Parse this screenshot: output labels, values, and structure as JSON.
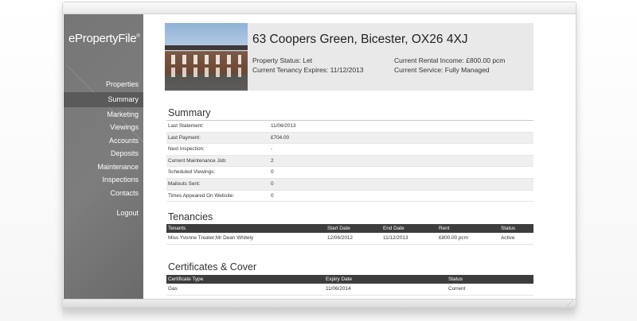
{
  "app": {
    "logo_text": "ePropertyFile",
    "logo_mark": "®"
  },
  "sidebar": {
    "items": [
      {
        "label": "Properties"
      },
      {
        "label": "Summary",
        "active": true
      },
      {
        "label": "Marketing"
      },
      {
        "label": "Viewings"
      },
      {
        "label": "Accounts"
      },
      {
        "label": "Deposits"
      },
      {
        "label": "Maintenance"
      },
      {
        "label": "Inspections"
      },
      {
        "label": "Contacts"
      }
    ],
    "logout_label": "Logout"
  },
  "property": {
    "address": "63 Coopers Green, Bicester, OX26 4XJ",
    "status": "Property Status: Let",
    "tenancy_expires": "Current Tenancy Expires: 11/12/2013",
    "rental_income": "Current Rental Income: £800.00 pcm",
    "service": "Current Service: Fully Managed"
  },
  "summary": {
    "title": "Summary",
    "rows": [
      {
        "label": "Last Statement:",
        "value": "11/06/2013"
      },
      {
        "label": "Last Payment:",
        "value": "£704.00"
      },
      {
        "label": "Next Inspection:",
        "value": "-"
      },
      {
        "label": "Current Maintenance Job:",
        "value": "2"
      },
      {
        "label": "Scheduled Viewings:",
        "value": "0"
      },
      {
        "label": "Mailouts Sent:",
        "value": "0"
      },
      {
        "label": "Times Appeared On Website:",
        "value": "0"
      }
    ]
  },
  "tenancies": {
    "title": "Tenancies",
    "columns": [
      "Tenants",
      "Start Date",
      "End Date",
      "Rent",
      "Status"
    ],
    "rows": [
      [
        "Miss Yvonne Treater;Mr Dean Whitely",
        "12/06/2012",
        "11/12/2013",
        "£800.00 pcm",
        "Active"
      ]
    ]
  },
  "certificates": {
    "title": "Certificates & Cover",
    "columns": [
      "Certificate Type",
      "Expiry Date",
      "Status"
    ],
    "rows": [
      [
        "Gas",
        "11/06/2014",
        "Current"
      ]
    ]
  },
  "window": {
    "resize_icon": "resize-grip-icon"
  }
}
